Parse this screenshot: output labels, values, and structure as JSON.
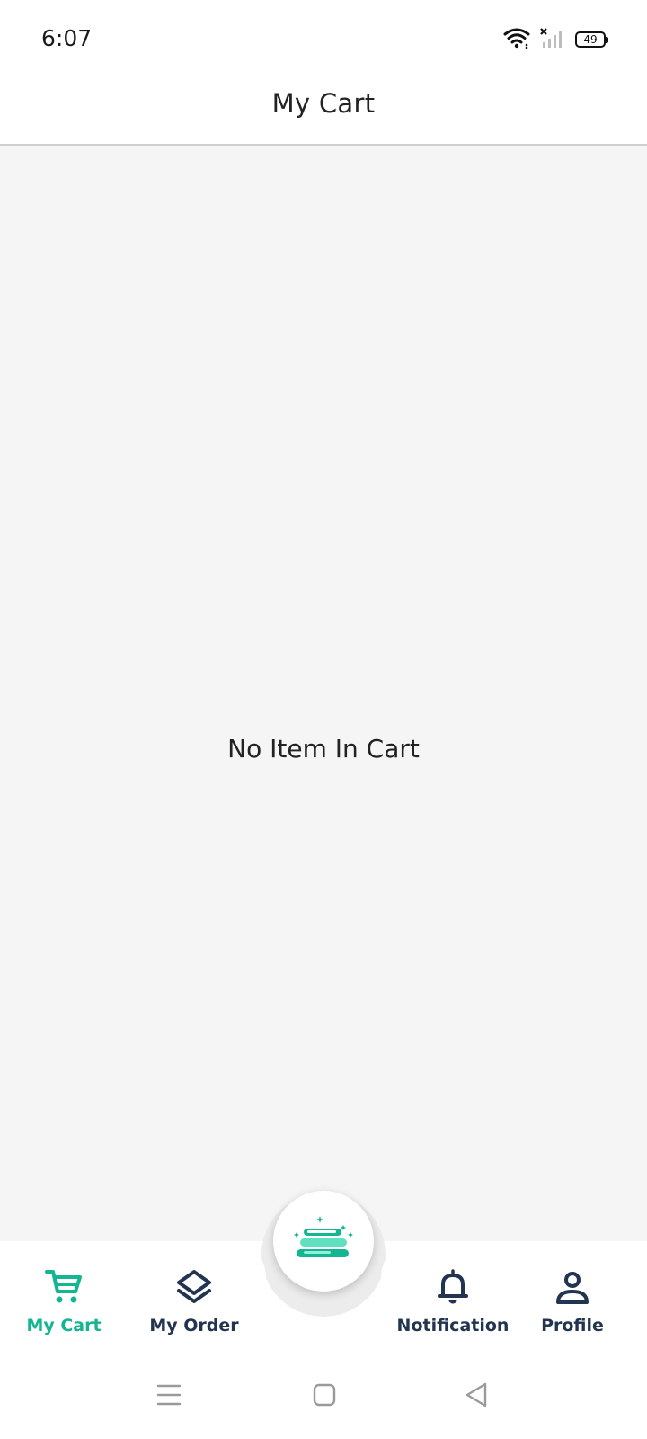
{
  "status_bar": {
    "time": "6:07",
    "battery_level": "49",
    "icons": [
      "wifi-icon",
      "signal-off-icon",
      "battery-icon"
    ]
  },
  "header": {
    "title": "My Cart"
  },
  "main": {
    "empty_message": "No Item In Cart"
  },
  "bottom_nav": {
    "center_icon": "laundry-stack-icon",
    "items": [
      {
        "label": "My Cart",
        "icon": "cart-icon",
        "active": true
      },
      {
        "label": "My Order",
        "icon": "layers-icon",
        "active": false
      },
      {
        "label": "Notification",
        "icon": "bell-icon",
        "active": false
      },
      {
        "label": "Profile",
        "icon": "user-icon",
        "active": false
      }
    ]
  },
  "system_nav": {
    "icons": [
      "menu-icon",
      "home-icon",
      "back-icon"
    ]
  },
  "colors": {
    "accent": "#13b592",
    "nav_text": "#22344f",
    "background": "#f5f5f5"
  }
}
